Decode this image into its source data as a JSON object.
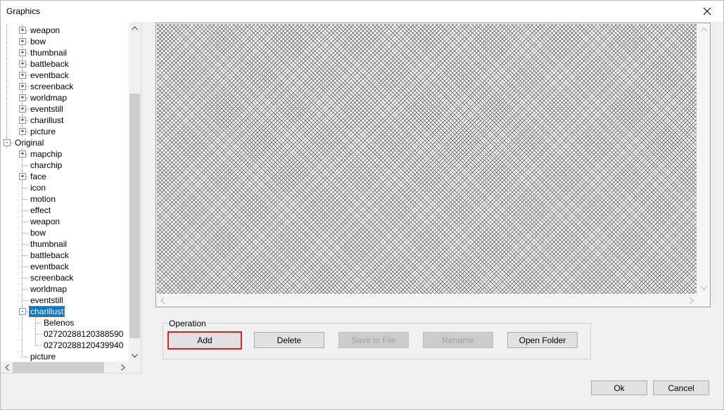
{
  "window": {
    "title": "Graphics",
    "close_symbol": "✕"
  },
  "tree": {
    "rows": [
      {
        "label": "weapon",
        "level": 1,
        "expander": "+"
      },
      {
        "label": "bow",
        "level": 1,
        "expander": "+"
      },
      {
        "label": "thumbnail",
        "level": 1,
        "expander": "+"
      },
      {
        "label": "battleback",
        "level": 1,
        "expander": "+"
      },
      {
        "label": "eventback",
        "level": 1,
        "expander": "+"
      },
      {
        "label": "screenback",
        "level": 1,
        "expander": "+"
      },
      {
        "label": "worldmap",
        "level": 1,
        "expander": "+"
      },
      {
        "label": "eventstill",
        "level": 1,
        "expander": "+"
      },
      {
        "label": "charillust",
        "level": 1,
        "expander": "+"
      },
      {
        "label": "picture",
        "level": 1,
        "expander": "+"
      },
      {
        "label": "Original",
        "level": 0,
        "expander": "-"
      },
      {
        "label": "mapchip",
        "level": 1,
        "expander": "+"
      },
      {
        "label": "charchip",
        "level": 1,
        "expander": ""
      },
      {
        "label": "face",
        "level": 1,
        "expander": "+"
      },
      {
        "label": "icon",
        "level": 1,
        "expander": ""
      },
      {
        "label": "motion",
        "level": 1,
        "expander": ""
      },
      {
        "label": "effect",
        "level": 1,
        "expander": ""
      },
      {
        "label": "weapon",
        "level": 1,
        "expander": ""
      },
      {
        "label": "bow",
        "level": 1,
        "expander": ""
      },
      {
        "label": "thumbnail",
        "level": 1,
        "expander": ""
      },
      {
        "label": "battleback",
        "level": 1,
        "expander": ""
      },
      {
        "label": "eventback",
        "level": 1,
        "expander": ""
      },
      {
        "label": "screenback",
        "level": 1,
        "expander": ""
      },
      {
        "label": "worldmap",
        "level": 1,
        "expander": ""
      },
      {
        "label": "eventstill",
        "level": 1,
        "expander": ""
      },
      {
        "label": "charillust",
        "level": 1,
        "expander": "-",
        "selected": true
      },
      {
        "label": "Belenos",
        "level": 2,
        "expander": ""
      },
      {
        "label": "02720288120388590",
        "level": 2,
        "expander": ""
      },
      {
        "label": "02720288120439940",
        "level": 2,
        "expander": ""
      },
      {
        "label": "picture",
        "level": 1,
        "expander": ""
      }
    ]
  },
  "operation": {
    "legend": "Operation",
    "add_label": "Add",
    "delete_label": "Delete",
    "save_label": "Save to File",
    "rename_label": "Rename",
    "open_folder_label": "Open Folder"
  },
  "footer": {
    "ok_label": "Ok",
    "cancel_label": "Cancel"
  },
  "colors": {
    "selection": "#0078d7",
    "focus_border": "#e0202a"
  }
}
